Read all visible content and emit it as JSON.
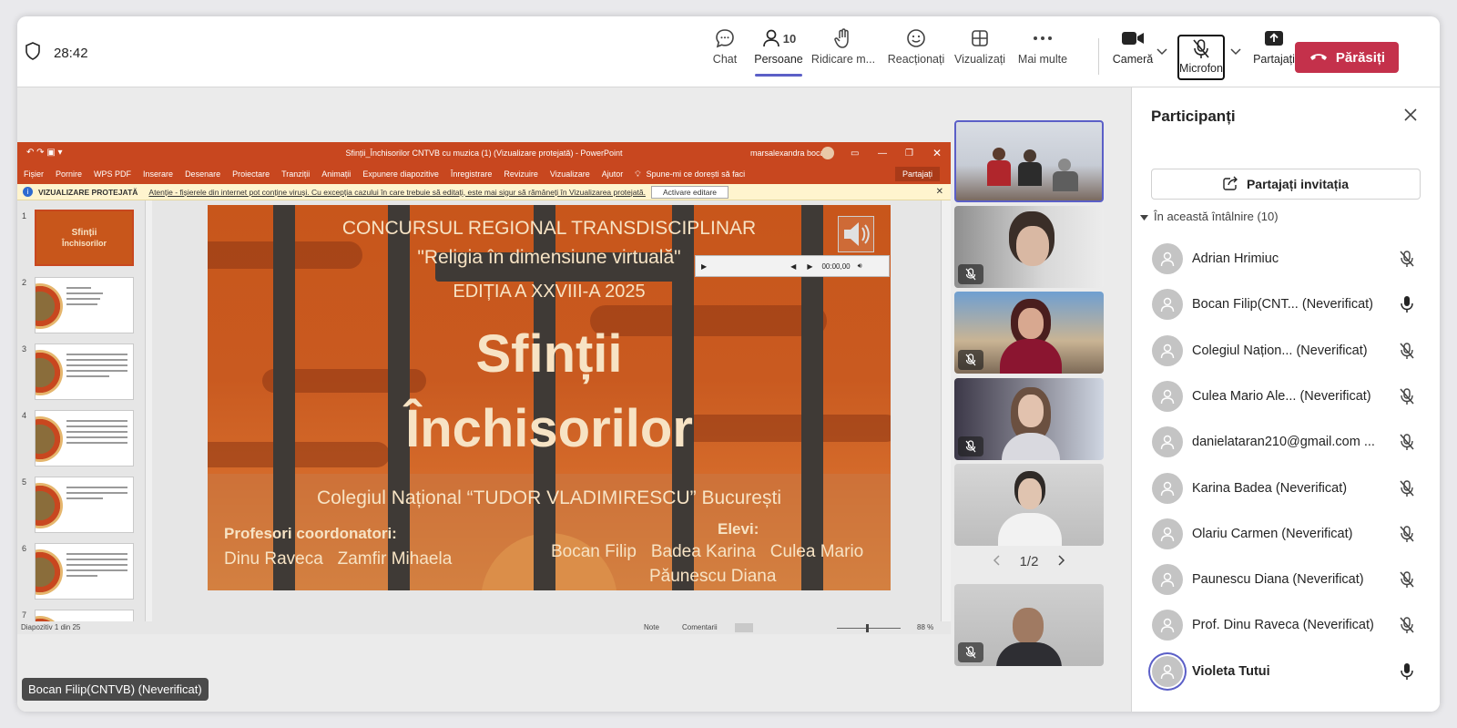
{
  "meeting": {
    "timer": "28:42",
    "toolbar": {
      "chat": "Chat",
      "people": "Persoane",
      "people_count": "10",
      "raise": "Ridicare m...",
      "react": "Reacționați",
      "view": "Vizualizați",
      "more": "Mai multe",
      "camera": "Cameră",
      "mic": "Microfon",
      "share": "Partajați",
      "leave": "Părăsiți"
    },
    "leave_color": "#c4314b",
    "accent": "#5b5fc7"
  },
  "ppt": {
    "window_title": "Sfinții_Închisorilor CNTVB cu muzica (1) (Vizualizare protejată) - PowerPoint",
    "user": "marsalexandra bocan",
    "menu": [
      "Fișier",
      "Pornire",
      "WPS PDF",
      "Inserare",
      "Desenare",
      "Proiectare",
      "Tranziții",
      "Animații",
      "Expunere diapozitive",
      "Înregistrare",
      "Revizuire",
      "Vizualizare",
      "Ajutor",
      "Spune-mi ce dorești să faci"
    ],
    "share_btn": "Partajați",
    "warn_title": "VIZUALIZARE PROTEJATĂ",
    "warn_text": "Atenție - fișierele din internet pot conține viruși. Cu excepția cazului în care trebuie să editați, este mai sigur să rămâneți în Vizualizarea protejată.",
    "warn_btn": "Activare editare",
    "thumb_numbers": [
      "1",
      "2",
      "3",
      "4",
      "5",
      "6",
      "7"
    ],
    "status_left": "Diapozitiv 1 din 25",
    "status_notes": "Note",
    "status_comments": "Comentarii",
    "zoom": "88 %",
    "audio_time": "00:00,00",
    "slide": {
      "line1": "CONCURSUL REGIONAL TRANSDISCIPLINAR",
      "line2": "\"Religia în dimensiune virtuală\"",
      "line3": "EDIȚIA A XXVIII-A 2025",
      "title1": "Sfinții",
      "title2": "Închisorilor",
      "school": "Colegiul Național “TUDOR VLADIMIRESCU” București",
      "prof_label": "Profesori coordonatori:",
      "profs": "Dinu Raveca   Zamfir Mihaela",
      "students_label": "Elevi:",
      "students1": "Bocan Filip   Badea Karina   Culea Mario",
      "students2": "Păunescu Diana"
    }
  },
  "stage": {
    "pager": "1/2",
    "speaker_label": "Bocan Filip(CNTVB) (Neverificat)"
  },
  "panel": {
    "title": "Participanți",
    "invite": "Partajați invitația",
    "section": "În această întâlnire (10)",
    "people": [
      {
        "name": "Adrian Hrimiuc",
        "mic": "off"
      },
      {
        "name": "Bocan Filip(CNT...  (Neverificat)",
        "mic": "on"
      },
      {
        "name": "Colegiul Națion...   (Neverificat)",
        "mic": "off"
      },
      {
        "name": "Culea Mario Ale...  (Neverificat)",
        "mic": "off"
      },
      {
        "name": "danielataran210@gmail.com ...",
        "mic": "off"
      },
      {
        "name": "Karina Badea (Neverificat)",
        "mic": "off"
      },
      {
        "name": "Olariu Carmen (Neverificat)",
        "mic": "off"
      },
      {
        "name": "Paunescu Diana (Neverificat)",
        "mic": "off"
      },
      {
        "name": "Prof. Dinu Raveca (Neverificat)",
        "mic": "off"
      },
      {
        "name": "Violeta Tutui",
        "mic": "on"
      }
    ]
  }
}
